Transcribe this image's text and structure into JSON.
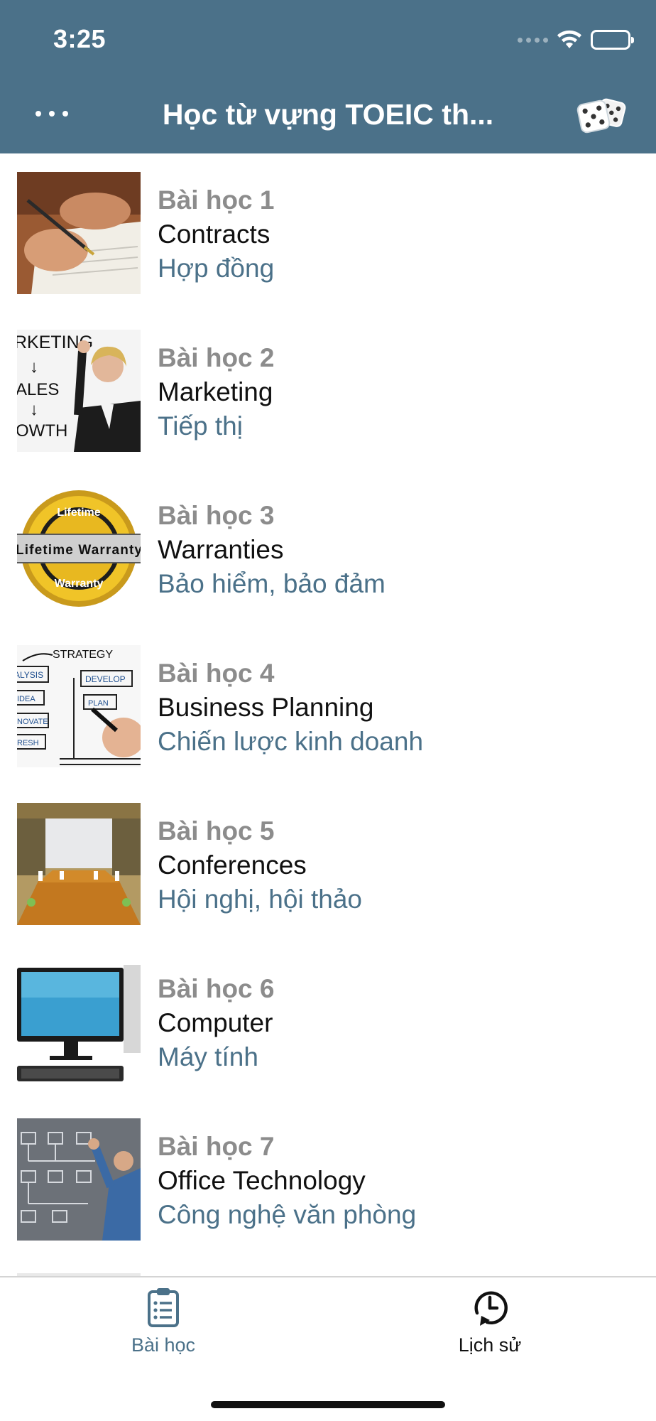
{
  "status_bar": {
    "time": "3:25"
  },
  "nav": {
    "title": "Học từ vựng TOEIC th...",
    "more_icon": "ellipsis-icon",
    "random_icon": "dice-icon"
  },
  "lessons": [
    {
      "number": "Bài học 1",
      "title": "Contracts",
      "subtitle": "Hợp đồng",
      "image": "contract-signing-photo"
    },
    {
      "number": "Bài học 2",
      "title": "Marketing",
      "subtitle": "Tiếp thị",
      "image": "marketing-whiteboard-photo",
      "image_text": [
        "RKETING",
        "↓",
        "ALES",
        "↓",
        "OWTH"
      ]
    },
    {
      "number": "Bài học 3",
      "title": "Warranties",
      "subtitle": "Bảo hiểm, bảo đảm",
      "image": "lifetime-warranty-seal",
      "image_text": [
        "Lifetime",
        "Lifetime Warranty",
        "Warranty"
      ]
    },
    {
      "number": "Bài học 4",
      "title": "Business Planning",
      "subtitle": "Chiến lược kinh doanh",
      "image": "strategy-diagram-photo",
      "image_text": [
        "STRATEGY",
        "ALYSIS",
        "DEVELOP",
        "IDEA",
        "PLAN",
        "NOVATE",
        "RESH"
      ]
    },
    {
      "number": "Bài học 5",
      "title": "Conferences",
      "subtitle": "Hội nghị, hội thảo",
      "image": "conference-room-photo"
    },
    {
      "number": "Bài học 6",
      "title": "Computer",
      "subtitle": "Máy tính",
      "image": "desktop-computer-photo"
    },
    {
      "number": "Bài học 7",
      "title": "Office Technology",
      "subtitle": "Công nghệ văn phòng",
      "image": "office-technology-photo"
    }
  ],
  "tabs": [
    {
      "label": "Bài học",
      "icon": "clipboard-list-icon",
      "active": true
    },
    {
      "label": "Lịch sử",
      "icon": "history-clock-icon",
      "active": false
    }
  ],
  "colors": {
    "header": "#4b7189",
    "accent": "#4b7189",
    "lesson_number": "#8c8c8c"
  }
}
